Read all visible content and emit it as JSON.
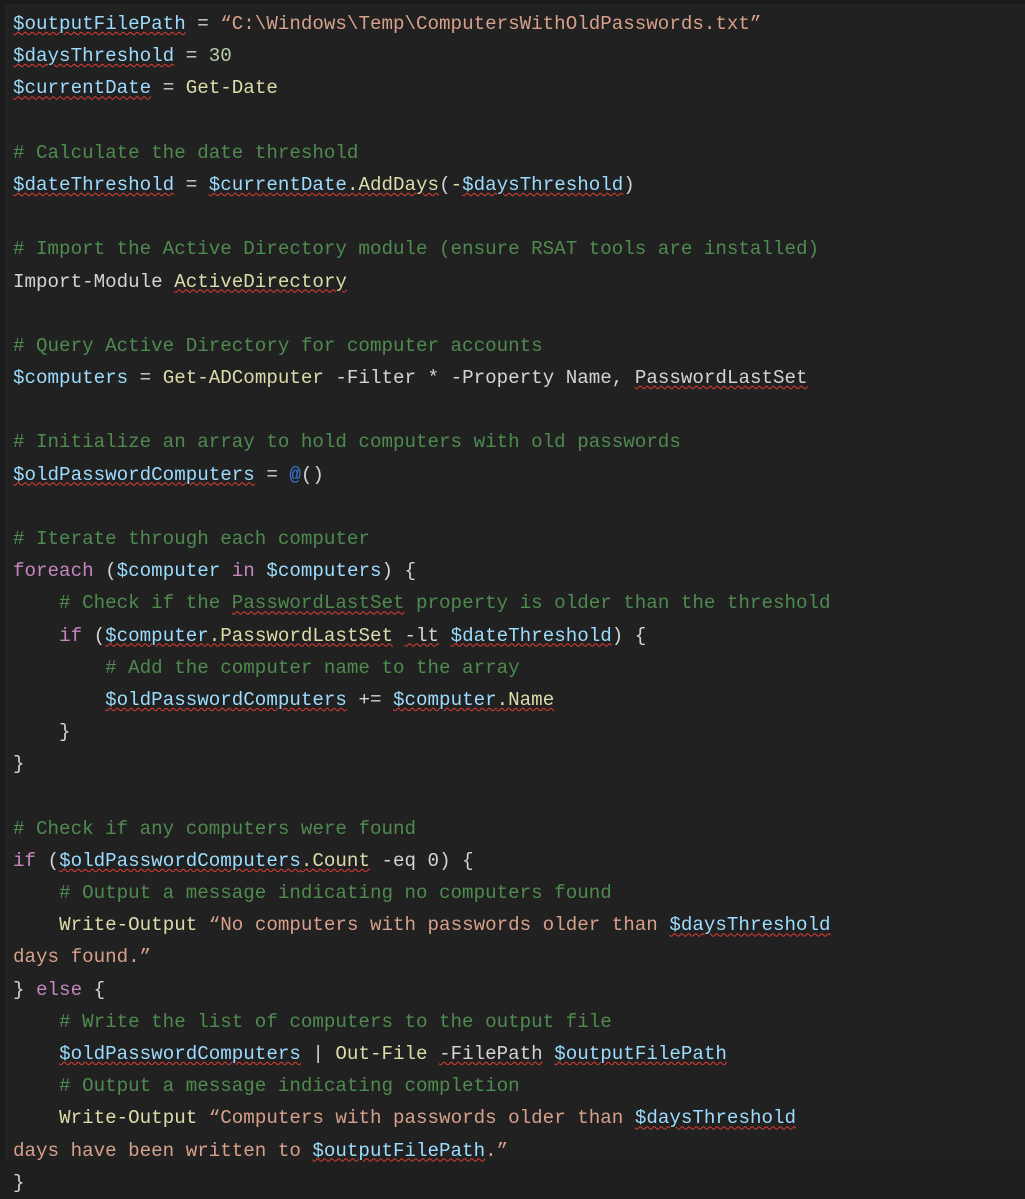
{
  "block": {
    "language": "powershell",
    "background_color": "#212121",
    "font_size_px": 19,
    "colors": {
      "variable": "#9cdcfe",
      "string": "#d7a08a",
      "number": "#b5cea8",
      "command": "#dcdcaa",
      "comment": "#4f8a4f",
      "keyword": "#c586c0",
      "plain": "#d4d4d4",
      "link": "#3b78d8",
      "spellcheck_underline": "#e03c31"
    }
  },
  "lines": [
    {
      "id": "l01",
      "text": "$outputFilePath = “C:\\Windows\\Temp\\ComputersWithOldPasswords.txt”"
    },
    {
      "id": "l02",
      "text": "$daysThreshold = 30"
    },
    {
      "id": "l03",
      "text": "$currentDate = Get-Date"
    },
    {
      "id": "l04",
      "text": ""
    },
    {
      "id": "l05",
      "text": "# Calculate the date threshold"
    },
    {
      "id": "l06",
      "text": "$dateThreshold = $currentDate.AddDays(-$daysThreshold)"
    },
    {
      "id": "l07",
      "text": ""
    },
    {
      "id": "l08",
      "text": "# Import the Active Directory module (ensure RSAT tools are installed)"
    },
    {
      "id": "l09",
      "text": "Import-Module ActiveDirectory"
    },
    {
      "id": "l10",
      "text": ""
    },
    {
      "id": "l11",
      "text": "# Query Active Directory for computer accounts"
    },
    {
      "id": "l12",
      "text": "$computers = Get-ADComputer -Filter * -Property Name, PasswordLastSet"
    },
    {
      "id": "l13",
      "text": ""
    },
    {
      "id": "l14",
      "text": "# Initialize an array to hold computers with old passwords"
    },
    {
      "id": "l15",
      "text": "$oldPasswordComputers = @()"
    },
    {
      "id": "l16",
      "text": ""
    },
    {
      "id": "l17",
      "text": "# Iterate through each computer"
    },
    {
      "id": "l18",
      "text": "foreach ($computer in $computers) {"
    },
    {
      "id": "l19",
      "text": "    # Check if the PasswordLastSet property is older than the threshold"
    },
    {
      "id": "l20",
      "text": "    if ($computer.PasswordLastSet -lt $dateThreshold) {"
    },
    {
      "id": "l21",
      "text": "        # Add the computer name to the array"
    },
    {
      "id": "l22",
      "text": "        $oldPasswordComputers += $computer.Name"
    },
    {
      "id": "l23",
      "text": "    }"
    },
    {
      "id": "l24",
      "text": "}"
    },
    {
      "id": "l25",
      "text": ""
    },
    {
      "id": "l26",
      "text": "# Check if any computers were found"
    },
    {
      "id": "l27",
      "text": "if ($oldPasswordComputers.Count -eq 0) {"
    },
    {
      "id": "l28",
      "text": "    # Output a message indicating no computers found"
    },
    {
      "id": "l29",
      "text": "    Write-Output “No computers with passwords older than $daysThreshold"
    },
    {
      "id": "l30",
      "text": "days found.”"
    },
    {
      "id": "l31",
      "text": "} else {"
    },
    {
      "id": "l32",
      "text": "    # Write the list of computers to the output file"
    },
    {
      "id": "l33",
      "text": "    $oldPasswordComputers | Out-File -FilePath $outputFilePath"
    },
    {
      "id": "l34",
      "text": "    # Output a message indicating completion"
    },
    {
      "id": "l35",
      "text": "    Write-Output “Computers with passwords older than $daysThreshold"
    },
    {
      "id": "l36",
      "text": "days have been written to $outputFilePath.”"
    },
    {
      "id": "l37",
      "text": "}"
    }
  ],
  "tokens": {
    "l01": [
      {
        "t": "$outputFilePath",
        "c": "tok-var",
        "sp": true
      },
      {
        "t": " ",
        "c": "tok-plain"
      },
      {
        "t": "=",
        "c": "tok-op"
      },
      {
        "t": " ",
        "c": "tok-plain"
      },
      {
        "t": "“C:\\Windows\\Temp\\ComputersWithOldPasswords.txt”",
        "c": "tok-str"
      }
    ],
    "l02": [
      {
        "t": "$daysThreshold",
        "c": "tok-var",
        "sp": true
      },
      {
        "t": " = ",
        "c": "tok-op"
      },
      {
        "t": "30",
        "c": "tok-num"
      }
    ],
    "l03": [
      {
        "t": "$currentDate",
        "c": "tok-var",
        "sp": true
      },
      {
        "t": " = ",
        "c": "tok-op"
      },
      {
        "t": "Get-Date",
        "c": "tok-cmd"
      }
    ],
    "l05": [
      {
        "t": "# Calculate the date threshold",
        "c": "tok-comment"
      }
    ],
    "l06": [
      {
        "t": "$dateThreshold",
        "c": "tok-var",
        "sp": true
      },
      {
        "t": " = ",
        "c": "tok-op"
      },
      {
        "t": "$currentDate",
        "c": "tok-var",
        "sp": true
      },
      {
        "t": ".AddDays",
        "c": "tok-prop",
        "sp": true
      },
      {
        "t": "(",
        "c": "tok-op"
      },
      {
        "t": "-",
        "c": "tok-cmd"
      },
      {
        "t": "$daysThreshold",
        "c": "tok-var",
        "sp": true
      },
      {
        "t": ")",
        "c": "tok-op"
      }
    ],
    "l08": [
      {
        "t": "# Import the Active Directory module (ensure RSAT tools are installed)",
        "c": "tok-comment"
      }
    ],
    "l09": [
      {
        "t": "Import-Module",
        "c": "tok-plain"
      },
      {
        "t": " ",
        "c": "tok-plain"
      },
      {
        "t": "ActiveDirectory",
        "c": "tok-cmd",
        "sp": true
      }
    ],
    "l11": [
      {
        "t": "# Query Active Directory for computer accounts",
        "c": "tok-comment"
      }
    ],
    "l12": [
      {
        "t": "$computers",
        "c": "tok-var"
      },
      {
        "t": " = ",
        "c": "tok-op"
      },
      {
        "t": "Get-ADComputer",
        "c": "tok-cmd"
      },
      {
        "t": " ",
        "c": "tok-plain"
      },
      {
        "t": "-Filter",
        "c": "tok-param"
      },
      {
        "t": " * ",
        "c": "tok-plain"
      },
      {
        "t": "-Property",
        "c": "tok-param"
      },
      {
        "t": " Name, ",
        "c": "tok-plain"
      },
      {
        "t": "PasswordLastSet",
        "c": "tok-plain",
        "sp": true
      }
    ],
    "l14": [
      {
        "t": "# Initialize an array to hold computers with old passwords",
        "c": "tok-comment"
      }
    ],
    "l15": [
      {
        "t": "$oldPasswordComputers",
        "c": "tok-var",
        "sp": true
      },
      {
        "t": " = ",
        "c": "tok-op"
      },
      {
        "t": "@",
        "c": "tok-link"
      },
      {
        "t": "()",
        "c": "tok-op"
      }
    ],
    "l17": [
      {
        "t": "# Iterate through each computer",
        "c": "tok-comment"
      }
    ],
    "l18": [
      {
        "t": "foreach",
        "c": "tok-kw"
      },
      {
        "t": " (",
        "c": "tok-op"
      },
      {
        "t": "$computer",
        "c": "tok-var"
      },
      {
        "t": " ",
        "c": "tok-plain"
      },
      {
        "t": "in",
        "c": "tok-kw"
      },
      {
        "t": " ",
        "c": "tok-plain"
      },
      {
        "t": "$computers",
        "c": "tok-var"
      },
      {
        "t": ") {",
        "c": "tok-op"
      }
    ],
    "l19": [
      {
        "t": "    # Check if the ",
        "c": "tok-comment"
      },
      {
        "t": "PasswordLastSet",
        "c": "tok-comment",
        "sp": true
      },
      {
        "t": " property is older than the threshold",
        "c": "tok-comment"
      }
    ],
    "l20": [
      {
        "t": "    ",
        "c": "tok-plain"
      },
      {
        "t": "if",
        "c": "tok-kw"
      },
      {
        "t": " (",
        "c": "tok-op"
      },
      {
        "t": "$computer",
        "c": "tok-var",
        "sp": true
      },
      {
        "t": ".PasswordLastSet",
        "c": "tok-prop",
        "sp": true
      },
      {
        "t": " ",
        "c": "tok-plain"
      },
      {
        "t": "-lt",
        "c": "tok-plain",
        "sp": true
      },
      {
        "t": " ",
        "c": "tok-plain"
      },
      {
        "t": "$dateThreshold",
        "c": "tok-var",
        "sp": true
      },
      {
        "t": ") {",
        "c": "tok-op"
      }
    ],
    "l21": [
      {
        "t": "        # Add the computer name to the array",
        "c": "tok-comment"
      }
    ],
    "l22": [
      {
        "t": "        ",
        "c": "tok-plain"
      },
      {
        "t": "$oldPasswordComputers",
        "c": "tok-var",
        "sp": true
      },
      {
        "t": " ",
        "c": "tok-plain"
      },
      {
        "t": "+=",
        "c": "tok-op"
      },
      {
        "t": " ",
        "c": "tok-plain"
      },
      {
        "t": "$computer",
        "c": "tok-var",
        "sp": true
      },
      {
        "t": ".Name",
        "c": "tok-prop",
        "sp": true
      }
    ],
    "l23": [
      {
        "t": "    }",
        "c": "tok-op"
      }
    ],
    "l24": [
      {
        "t": "}",
        "c": "tok-op"
      }
    ],
    "l26": [
      {
        "t": "# Check if any computers were found",
        "c": "tok-comment"
      }
    ],
    "l27": [
      {
        "t": "if",
        "c": "tok-kw"
      },
      {
        "t": " (",
        "c": "tok-op"
      },
      {
        "t": "$oldPasswordComputers",
        "c": "tok-var",
        "sp": true
      },
      {
        "t": ".Count",
        "c": "tok-prop",
        "sp": true
      },
      {
        "t": " ",
        "c": "tok-plain"
      },
      {
        "t": "-eq",
        "c": "tok-plain"
      },
      {
        "t": " ",
        "c": "tok-plain"
      },
      {
        "t": "0",
        "c": "tok-plain"
      },
      {
        "t": ") {",
        "c": "tok-op"
      }
    ],
    "l28": [
      {
        "t": "    # Output a message indicating no computers found",
        "c": "tok-comment"
      }
    ],
    "l29": [
      {
        "t": "    ",
        "c": "tok-plain"
      },
      {
        "t": "Write-Output",
        "c": "tok-cmd"
      },
      {
        "t": " ",
        "c": "tok-plain"
      },
      {
        "t": "“No computers with passwords older than ",
        "c": "tok-str"
      },
      {
        "t": "$daysThreshold",
        "c": "tok-var",
        "sp": true
      }
    ],
    "l30": [
      {
        "t": "days found.”",
        "c": "tok-str"
      }
    ],
    "l31": [
      {
        "t": "} ",
        "c": "tok-op"
      },
      {
        "t": "else",
        "c": "tok-kw"
      },
      {
        "t": " {",
        "c": "tok-op"
      }
    ],
    "l32": [
      {
        "t": "    # Write the list of computers to the output file",
        "c": "tok-comment"
      }
    ],
    "l33": [
      {
        "t": "    ",
        "c": "tok-plain"
      },
      {
        "t": "$oldPasswordComputers",
        "c": "tok-var",
        "sp": true
      },
      {
        "t": " | ",
        "c": "tok-op"
      },
      {
        "t": "Out-File",
        "c": "tok-cmd"
      },
      {
        "t": " ",
        "c": "tok-plain"
      },
      {
        "t": "-FilePath",
        "c": "tok-param",
        "sp": true
      },
      {
        "t": " ",
        "c": "tok-plain"
      },
      {
        "t": "$outputFilePath",
        "c": "tok-var",
        "sp": true
      }
    ],
    "l34": [
      {
        "t": "    # Output a message indicating completion",
        "c": "tok-comment"
      }
    ],
    "l35": [
      {
        "t": "    ",
        "c": "tok-plain"
      },
      {
        "t": "Write-Output",
        "c": "tok-cmd"
      },
      {
        "t": " ",
        "c": "tok-plain"
      },
      {
        "t": "“Computers with passwords older than ",
        "c": "tok-str"
      },
      {
        "t": "$daysThreshold",
        "c": "tok-var",
        "sp": true
      }
    ],
    "l36": [
      {
        "t": "days have been written to ",
        "c": "tok-str"
      },
      {
        "t": "$outputFilePath",
        "c": "tok-var",
        "sp": true
      },
      {
        "t": ".”",
        "c": "tok-str"
      }
    ],
    "l37": [
      {
        "t": "}",
        "c": "tok-op"
      }
    ]
  }
}
